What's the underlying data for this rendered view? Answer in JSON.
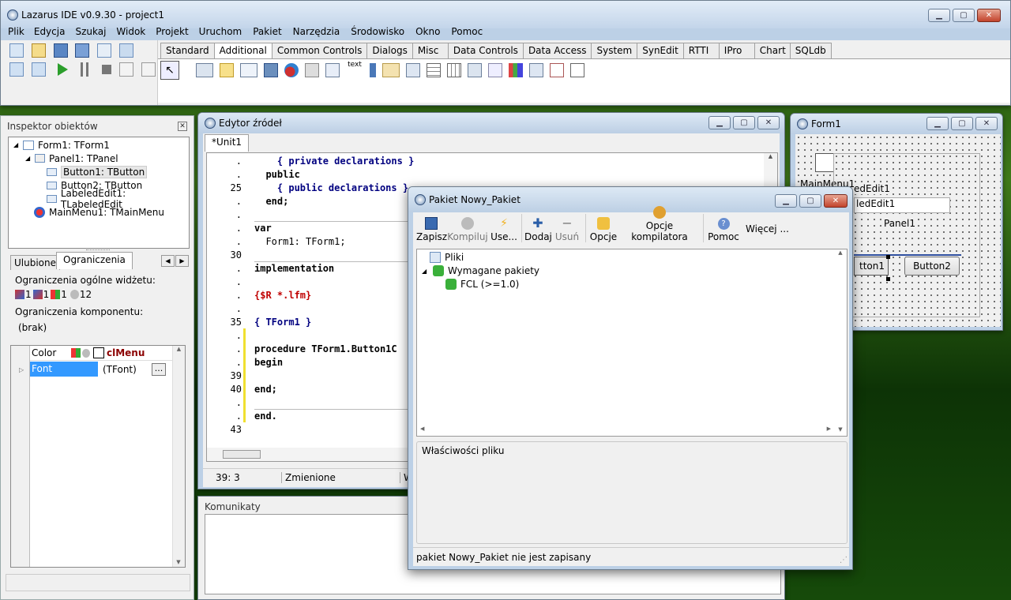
{
  "main": {
    "title": "Lazarus IDE v0.9.30 - project1",
    "menu": [
      "Plik",
      "Edycja",
      "Szukaj",
      "Widok",
      "Projekt",
      "Uruchom",
      "Pakiet",
      "Narzędzia",
      "Środowisko",
      "Okno",
      "Pomoc"
    ],
    "palette_tabs": [
      "Standard",
      "Additional",
      "Common Controls",
      "Dialogs",
      "Misc",
      "Data Controls",
      "Data Access",
      "System",
      "SynEdit",
      "RTTI",
      "IPro",
      "Chart",
      "SQLdb"
    ],
    "palette_icon_text": "text"
  },
  "inspector": {
    "title": "Inspektor obiektów",
    "tree": [
      "Form1: TForm1",
      "Panel1: TPanel",
      "Button1: TButton",
      "Button2: TButton",
      "LabeledEdit1: TLabeledEdit",
      "MainMenu1: TMainMenu"
    ],
    "tabs": [
      "Ulubione",
      "Ograniczenia"
    ],
    "general_label": "Ograniczenia ogólne widżetu:",
    "counts": [
      "1",
      "1",
      "1",
      "12"
    ],
    "component_label": "Ograniczenia komponentu:",
    "component_value": "(brak)",
    "grid": [
      {
        "name": "Color",
        "value": "clMenu"
      },
      {
        "name": "Font",
        "value": "(TFont)",
        "button": "..."
      }
    ]
  },
  "editor": {
    "title": "Edytor źródeł",
    "tab": "*Unit1",
    "gutter": [
      ".",
      ".",
      "25",
      ".",
      ".",
      ".",
      ".",
      "30",
      ".",
      ".",
      ".",
      ".",
      "35",
      ".",
      ".",
      ".",
      "39",
      "40",
      ".",
      ".",
      "43"
    ],
    "lines": [
      "    { private declarations }",
      "  public",
      "    { public declarations }",
      "  end;",
      "",
      "var",
      "  Form1: TForm1;",
      "",
      "implementation",
      "",
      "{$R *.lfm}",
      "",
      "{ TForm1 }",
      "",
      "procedure TForm1.Button1C",
      "begin",
      "",
      "end;",
      "",
      "end.",
      ""
    ],
    "status": {
      "pos": "39:  3",
      "state": "Zmienione",
      "extra": "W"
    }
  },
  "messages": {
    "title": "Komunikaty"
  },
  "form1": {
    "title": "Form1",
    "labels": {
      "mainmenu": "MainMenu1",
      "labeled": "edEdit1",
      "edit": "ledEdit1",
      "panel": "Panel1",
      "button1": "tton1",
      "button2": "Button2"
    }
  },
  "package": {
    "title": "Pakiet Nowy_Pakiet",
    "toolbar": [
      "Zapisz",
      "Kompiluj",
      "Use...",
      "Dodaj",
      "Usuń",
      "Opcje",
      "Opcje kompilatora",
      "Pomoc",
      "Więcej ..."
    ],
    "tree": {
      "files": "Pliki",
      "required": "Wymagane pakiety",
      "fcl": "FCL (>=1.0)"
    },
    "props_label": "Właściwości pliku",
    "status": "pakiet Nowy_Pakiet nie jest zapisany"
  }
}
